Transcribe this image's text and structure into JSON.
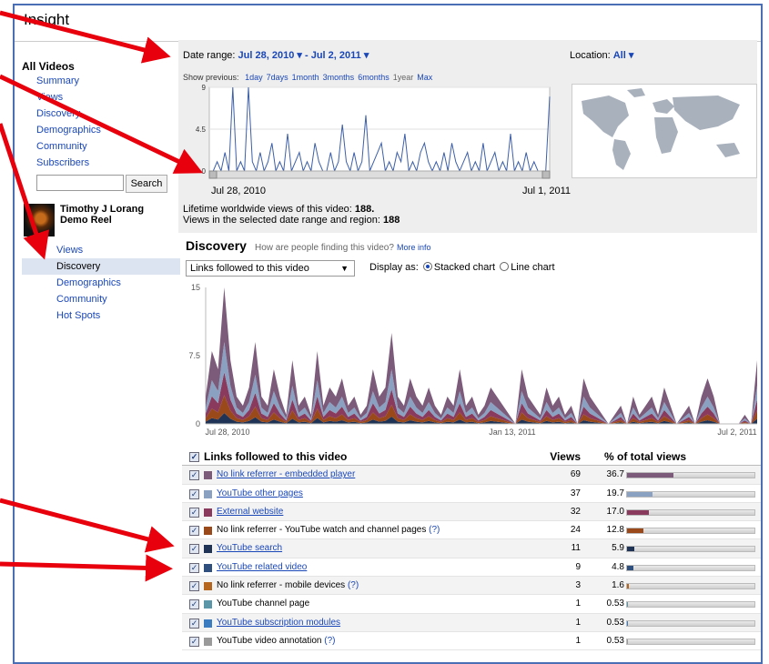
{
  "window": {
    "title": "Insight"
  },
  "sidebar": {
    "heading": "All Videos",
    "links": [
      "Summary",
      "Views",
      "Discovery",
      "Demographics",
      "Community",
      "Subscribers"
    ],
    "search_button": "Search",
    "video_title": "Timothy J Lorang Demo Reel",
    "sub_links": [
      "Views",
      "Discovery",
      "Demographics",
      "Community",
      "Hot Spots"
    ],
    "active_sub": "Discovery"
  },
  "top": {
    "date_range_label": "Date range:",
    "date_start": "Jul 28, 2010",
    "date_end": "Jul 2, 2011",
    "location_label": "Location:",
    "location_value": "All",
    "show_previous_label": "Show previous:",
    "show_previous_options": [
      "1day",
      "7days",
      "1month",
      "3months",
      "6months",
      "1year",
      "Max"
    ],
    "spark_y_ticks": [
      "9",
      "4.5",
      "0"
    ],
    "spark_values": [
      0,
      0,
      1,
      0,
      2,
      0,
      9,
      0,
      1,
      0,
      9,
      1,
      0,
      2,
      0,
      1,
      3,
      0,
      1,
      0,
      4,
      0,
      1,
      2,
      0,
      1,
      0,
      3,
      1,
      0,
      0,
      2,
      0,
      1,
      5,
      1,
      0,
      2,
      0,
      1,
      6,
      0,
      1,
      2,
      3,
      0,
      1,
      0,
      2,
      1,
      4,
      0,
      1,
      0,
      2,
      3,
      1,
      0,
      1,
      0,
      2,
      0,
      3,
      1,
      0,
      1,
      2,
      0,
      1,
      0,
      3,
      0,
      1,
      2,
      0,
      1,
      0,
      4,
      0,
      1,
      0,
      2,
      0,
      1,
      0,
      0,
      0,
      8
    ],
    "date_axis_left": "Jul 28, 2010",
    "date_axis_right": "Jul 1, 2011",
    "lifetime_label": "Lifetime worldwide views of this video:",
    "lifetime_value": "188.",
    "selected_label": "Views in the selected date range and region:",
    "selected_value": "188"
  },
  "discovery": {
    "heading": "Discovery",
    "question": "How are people finding this video?",
    "more_info": "More info",
    "dropdown_value": "Links followed to this video",
    "display_as_label": "Display as:",
    "stacked_label": "Stacked chart",
    "line_label": "Line chart"
  },
  "chart_data": {
    "type": "area",
    "y_ticks": [
      "15",
      "7.5",
      "0"
    ],
    "ylim": [
      0,
      15
    ],
    "x_tick_labels": [
      "Jul 28, 2010",
      "Jan 13, 2011",
      "Jul 2, 2011"
    ],
    "total": [
      3,
      8,
      6,
      15,
      7,
      3,
      2,
      4,
      9,
      3,
      2,
      6,
      3,
      1,
      7,
      2,
      3,
      1,
      8,
      2,
      4,
      3,
      5,
      2,
      3,
      1,
      2,
      6,
      3,
      4,
      10,
      3,
      2,
      5,
      3,
      2,
      4,
      2,
      1,
      3,
      2,
      6,
      2,
      3,
      1,
      2,
      4,
      3,
      2,
      1,
      0,
      6,
      3,
      2,
      1,
      4,
      2,
      3,
      1,
      2,
      0,
      5,
      3,
      2,
      1,
      0,
      1,
      2,
      0,
      3,
      1,
      2,
      3,
      1,
      4,
      2,
      0,
      1,
      2,
      0,
      3,
      5,
      3,
      0,
      0,
      0,
      0,
      1,
      0,
      7
    ],
    "series": [
      {
        "name": "No link referrer - embedded player",
        "color": "#7b5a7a"
      },
      {
        "name": "YouTube other pages",
        "color": "#8ba1c2"
      },
      {
        "name": "External website",
        "color": "#8a3a5c"
      },
      {
        "name": "No link referrer - YouTube watch and channel pages",
        "color": "#9a4a1a"
      },
      {
        "name": "YouTube search",
        "color": "#1e3356"
      }
    ]
  },
  "table": {
    "header_label": "Links followed to this video",
    "header_views": "Views",
    "header_pct": "% of total views",
    "rows": [
      {
        "label": "No link referrer - embedded player",
        "link": true,
        "q": "",
        "views": "69",
        "pct": "36.7",
        "frac": 0.367,
        "color": "#7b5a7a"
      },
      {
        "label": "YouTube other pages",
        "link": true,
        "q": "",
        "views": "37",
        "pct": "19.7",
        "frac": 0.197,
        "color": "#8ba1c2"
      },
      {
        "label": "External website",
        "link": true,
        "q": "",
        "views": "32",
        "pct": "17.0",
        "frac": 0.17,
        "color": "#8a3a5c"
      },
      {
        "label": "No link referrer - YouTube watch and channel pages",
        "link": false,
        "q": "(?)",
        "views": "24",
        "pct": "12.8",
        "frac": 0.128,
        "color": "#9a4a1a"
      },
      {
        "label": "YouTube search",
        "link": true,
        "q": "",
        "views": "11",
        "pct": "5.9",
        "frac": 0.059,
        "color": "#1e3356"
      },
      {
        "label": "YouTube related video",
        "link": true,
        "q": "",
        "views": "9",
        "pct": "4.8",
        "frac": 0.048,
        "color": "#2f4f7f"
      },
      {
        "label": "No link referrer - mobile devices",
        "link": false,
        "q": "(?)",
        "views": "3",
        "pct": "1.6",
        "frac": 0.016,
        "color": "#b5651d"
      },
      {
        "label": "YouTube channel page",
        "link": false,
        "q": "",
        "views": "1",
        "pct": "0.53",
        "frac": 0.0053,
        "color": "#5a96a8"
      },
      {
        "label": "YouTube subscription modules",
        "link": true,
        "q": "",
        "views": "1",
        "pct": "0.53",
        "frac": 0.0053,
        "color": "#3b7bbf"
      },
      {
        "label": "YouTube video annotation",
        "link": false,
        "q": "(?)",
        "views": "1",
        "pct": "0.53",
        "frac": 0.0053,
        "color": "#9a9a9a"
      }
    ]
  }
}
